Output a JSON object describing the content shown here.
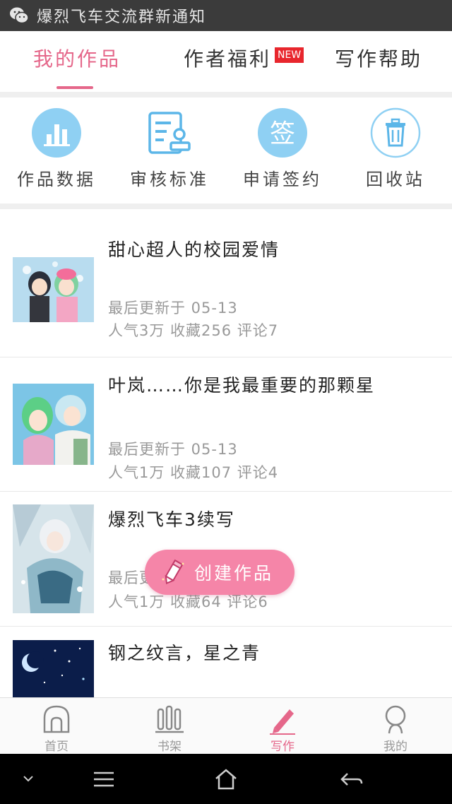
{
  "notification": {
    "icon": "wechat-icon",
    "text": "爆烈飞车交流群新通知"
  },
  "tabs": [
    {
      "label": "我的作品",
      "active": true
    },
    {
      "label": "作者福利",
      "badge": "NEW"
    },
    {
      "label": "写作帮助"
    }
  ],
  "actions": [
    {
      "label": "作品数据",
      "icon": "bar-chart-icon"
    },
    {
      "label": "审核标准",
      "icon": "document-stamp-icon"
    },
    {
      "label": "申请签约",
      "icon": "sign-icon",
      "icon_text": "签"
    },
    {
      "label": "回收站",
      "icon": "trash-icon"
    }
  ],
  "works": [
    {
      "title": "甜心超人的校园爱情",
      "updated": "最后更新于 05-13",
      "stats": "人气3万 收藏256 评论7"
    },
    {
      "title": "叶岚……你是我最重要的那颗星",
      "updated": "最后更新于 05-13",
      "stats": "人气1万 收藏107 评论4"
    },
    {
      "title": "爆烈飞车3续写",
      "updated": "最后更新于 05-13",
      "stats": "人气1万 收藏64 评论6"
    },
    {
      "title": "钢之纹言，星之青"
    }
  ],
  "fab": {
    "label": "创建作品",
    "icon": "pencil-icon"
  },
  "bottom_nav": [
    {
      "label": "首页",
      "icon": "home-arch-icon"
    },
    {
      "label": "书架",
      "icon": "bookshelf-icon"
    },
    {
      "label": "写作",
      "icon": "pen-icon",
      "active": true
    },
    {
      "label": "我的",
      "icon": "profile-icon"
    }
  ],
  "colors": {
    "accent": "#e5678a",
    "action_blue": "#4fb2e8",
    "fab": "#f585a8",
    "badge_red": "#e8262d"
  }
}
